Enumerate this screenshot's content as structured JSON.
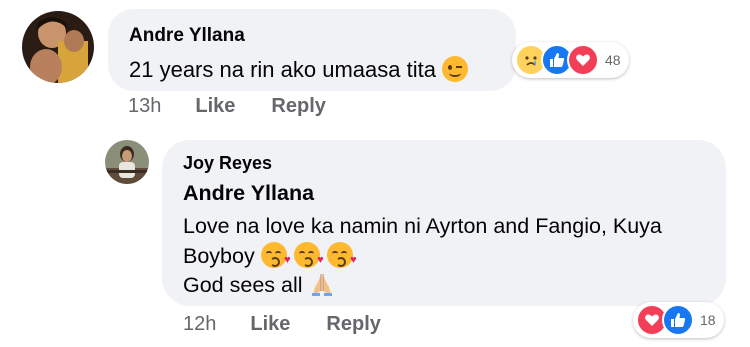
{
  "comments": [
    {
      "author": "Andre Yllana",
      "text": "21 years na rin ako umaasa tita",
      "emoji": "winking-face",
      "time": "13h",
      "like_label": "Like",
      "reply_label": "Reply",
      "reaction_count": "48",
      "reactions": [
        "crying-face",
        "like",
        "love"
      ]
    },
    {
      "author": "Joy Reyes",
      "mention": "Andre Yllana",
      "line1": "Love na love ka namin ni Ayrton and Fangio, Kuya",
      "line2": "Boyboy",
      "line2_emoji": "face-blowing-kiss x3",
      "line3": "God sees all",
      "line3_emoji": "folded-hands",
      "time": "12h",
      "like_label": "Like",
      "reply_label": "Reply",
      "reaction_count": "18",
      "reactions": [
        "love",
        "like"
      ]
    }
  ],
  "colors": {
    "bubble": "#f0f2f5",
    "meta_text": "#65676b",
    "like_blue": "#1877f2",
    "love_red": "#f33e58"
  }
}
